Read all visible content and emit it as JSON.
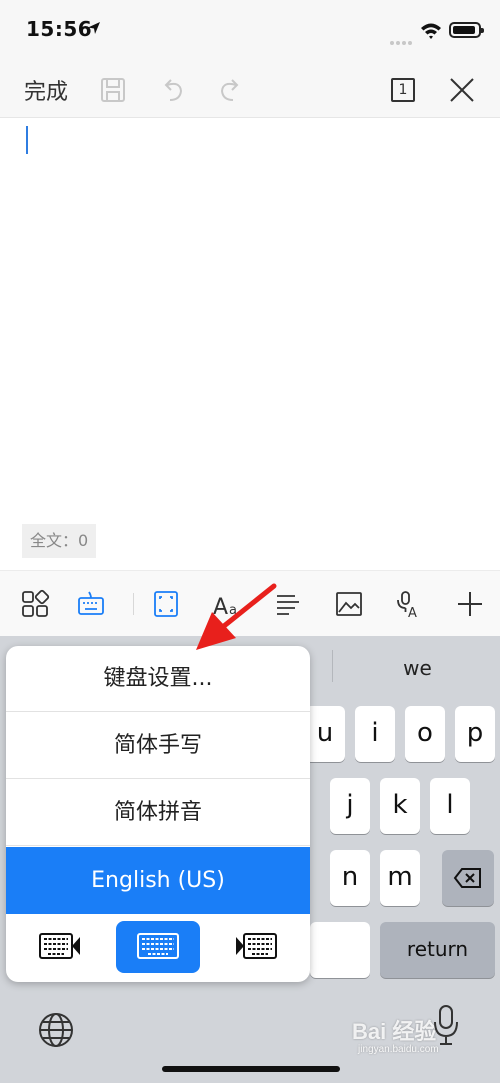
{
  "status_bar": {
    "time": "15:56"
  },
  "toolbar": {
    "done_label": "完成",
    "page_count": "1"
  },
  "editor": {
    "word_count": "全文：0"
  },
  "keyboard": {
    "suggestion": "we",
    "row1": [
      "u",
      "i",
      "o",
      "p"
    ],
    "row2": [
      "j",
      "k",
      "l"
    ],
    "row3": [
      "n",
      "m"
    ],
    "return_label": "return"
  },
  "popup_menu": {
    "items": [
      {
        "label": "键盘设置..."
      },
      {
        "label": "简体手写"
      },
      {
        "label": "简体拼音"
      },
      {
        "label": "English (US)",
        "selected": true
      }
    ],
    "accent_color": "#1a7ef7"
  },
  "watermark": {
    "brand": "Bai 经验",
    "site": "jingyan.baidu.com"
  }
}
